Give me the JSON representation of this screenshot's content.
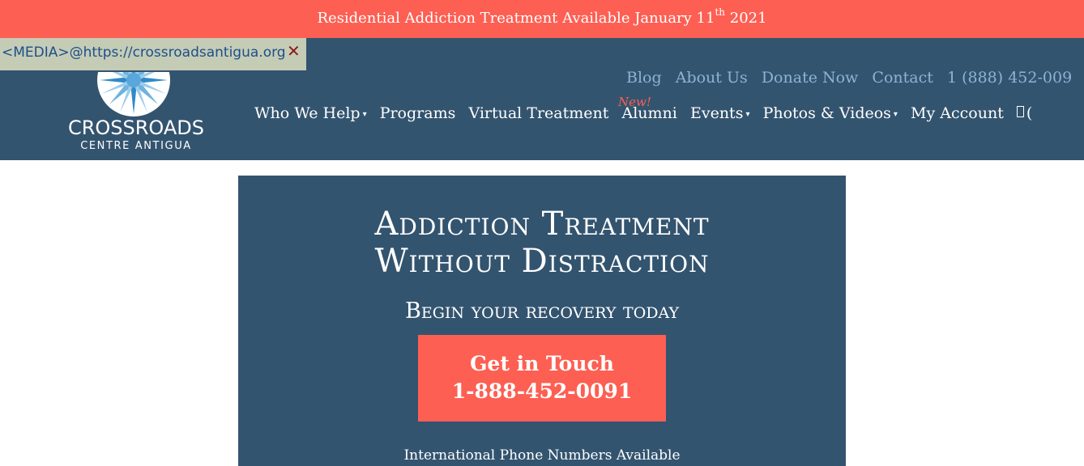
{
  "announcement": {
    "text": "Residential Addiction Treatment Available January 11",
    "superscript": "th",
    "year": " 2021"
  },
  "tooltip": {
    "text": "<MEDIA>@https://crossroadsantigua.org",
    "close_symbol": "✕"
  },
  "logo": {
    "line1": "CROSSROADS",
    "line2": "CENTRE ANTIGUA"
  },
  "top_nav": [
    "Blog",
    "About Us",
    "Donate Now",
    "Contact",
    "1 (888) 452-009"
  ],
  "main_nav": [
    {
      "label": "Who We Help",
      "caret": "▾"
    },
    {
      "label": "Programs"
    },
    {
      "label": "Virtual Treatment"
    },
    {
      "label": "Alumni"
    },
    {
      "label": "Events",
      "caret": "▾"
    },
    {
      "label": "Photos & Videos",
      "caret": "▾"
    },
    {
      "label": "My Account"
    },
    {
      "label": "("
    }
  ],
  "new_badge": "New!",
  "hero": {
    "title_line1": "Addiction Treatment",
    "title_line2": "Without Distraction",
    "subtitle": "Begin your recovery today",
    "cta_line1": "Get in Touch",
    "cta_line2": "1-888-452-0091",
    "intl_link": "International Phone Numbers Available"
  },
  "colors": {
    "coral": "#fd5f53",
    "navy": "#33546f",
    "link_blue": "#8cb3d6"
  },
  "icons": [
    "compass-rose-icon",
    "flag-icon",
    "close-icon",
    "caret-down-icon"
  ]
}
